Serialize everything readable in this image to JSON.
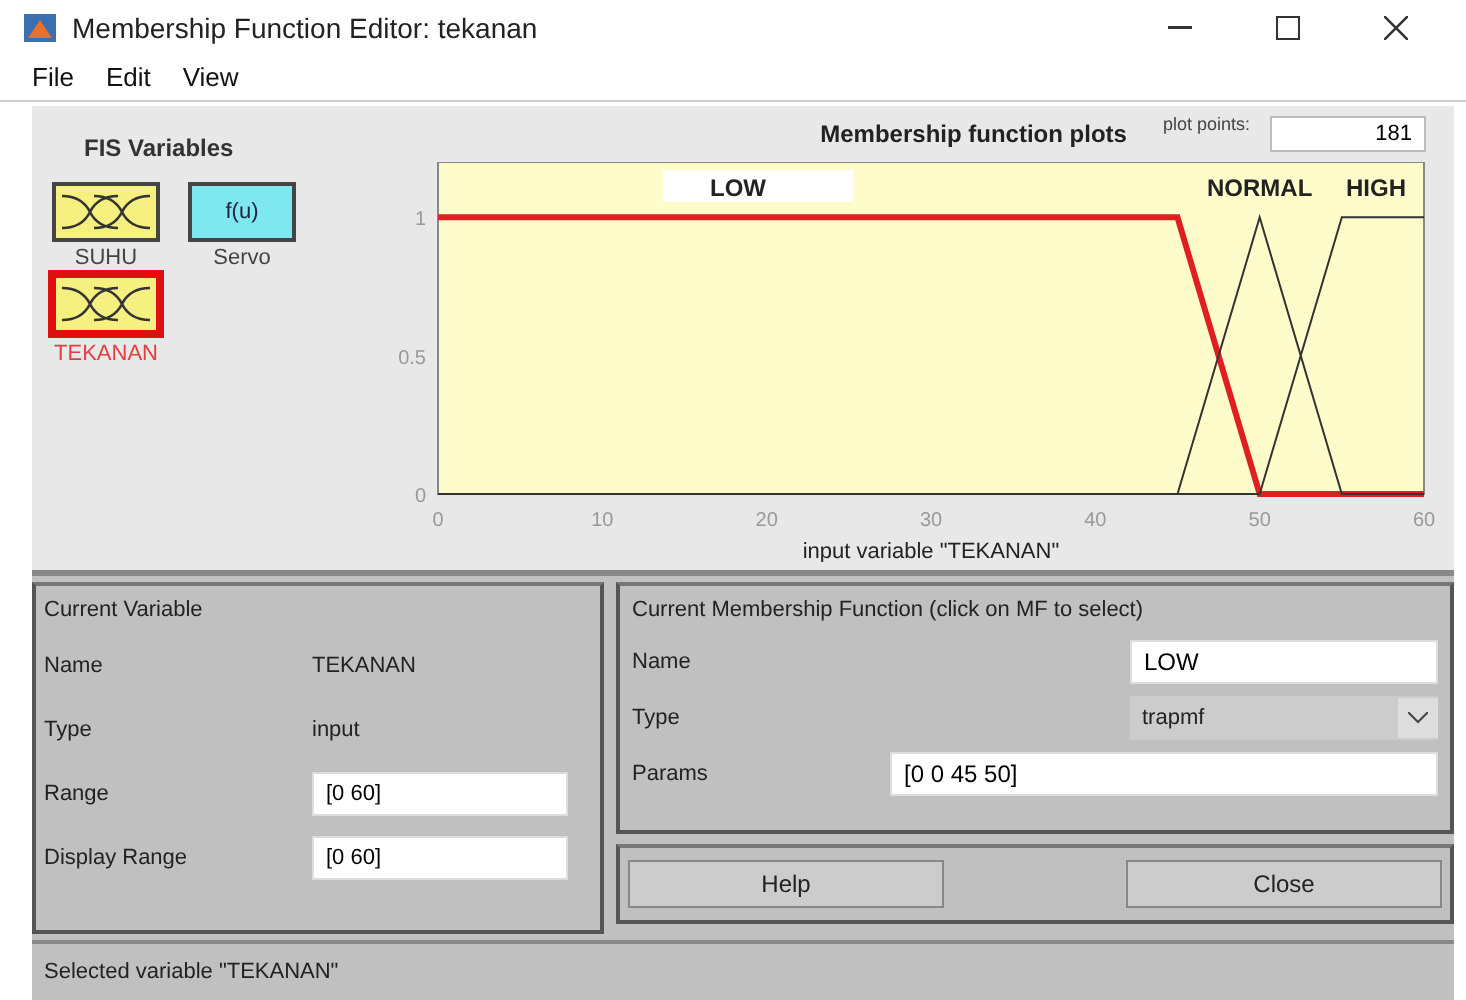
{
  "window": {
    "title": "Membership Function Editor: tekanan"
  },
  "menu": [
    "File",
    "Edit",
    "View"
  ],
  "fis_variables": {
    "title": "FIS Variables",
    "items": [
      {
        "name": "SUHU",
        "kind": "input",
        "selected": false
      },
      {
        "name": "Servo",
        "kind": "output",
        "icon_text": "f(u)",
        "selected": false
      },
      {
        "name": "TEKANAN",
        "kind": "input",
        "selected": true
      }
    ]
  },
  "plot": {
    "plot_points_label": "plot points:",
    "plot_points": "181",
    "chart_data": {
      "type": "line",
      "title": "Membership function plots",
      "xlabel": "input variable \"TEKANAN\"",
      "x": [
        0,
        45,
        50,
        55,
        60
      ],
      "xlim": [
        0,
        60
      ],
      "ylim": [
        0,
        1.2
      ],
      "xticks": [
        0,
        10,
        20,
        30,
        40,
        50,
        60
      ],
      "yticks": [
        0,
        0.5,
        1
      ],
      "series": [
        {
          "name": "LOW",
          "color": "#e02020",
          "values": [
            1,
            1,
            0,
            0,
            0
          ]
        },
        {
          "name": "NORMAL",
          "color": "#333333",
          "values": [
            0,
            0,
            1,
            0,
            0
          ]
        },
        {
          "name": "HIGH",
          "color": "#333333",
          "values": [
            0,
            0,
            0,
            1,
            1
          ]
        }
      ]
    }
  },
  "current_variable": {
    "title": "Current Variable",
    "name_label": "Name",
    "name": "TEKANAN",
    "type_label": "Type",
    "type": "input",
    "range_label": "Range",
    "range": "[0 60]",
    "display_range_label": "Display Range",
    "display_range": "[0 60]"
  },
  "current_mf": {
    "title": "Current Membership Function (click on MF to select)",
    "name_label": "Name",
    "name": "LOW",
    "type_label": "Type",
    "type": "trapmf",
    "params_label": "Params",
    "params": "[0 0 45 50]"
  },
  "buttons": [
    "Help",
    "Close"
  ],
  "status_bar": "Selected variable \"TEKANAN\""
}
